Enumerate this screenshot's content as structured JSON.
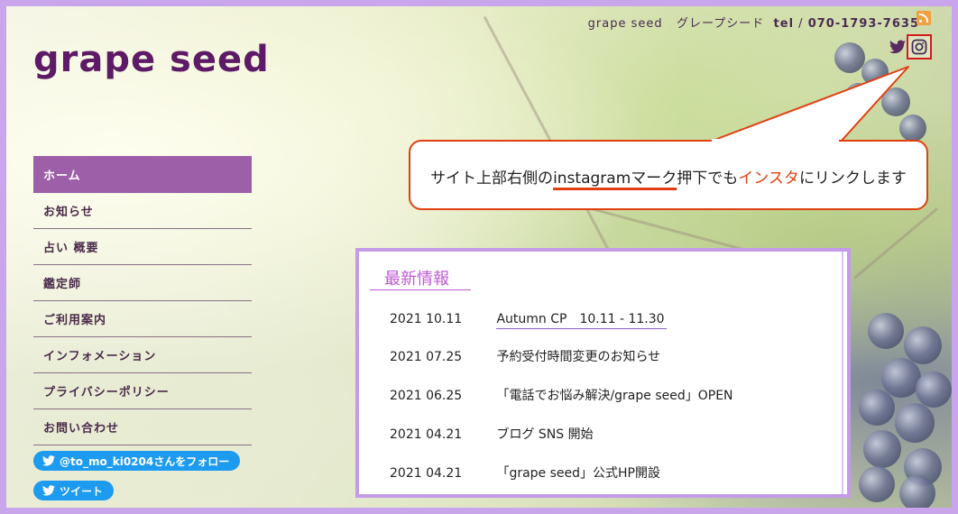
{
  "header": {
    "site_name_small": "grape seed",
    "site_name_kana": "グレープシード",
    "tel_label": "tel",
    "tel_number": "070-1793-7635",
    "rss_icon": "rss-icon",
    "twitter_icon": "twitter-icon",
    "instagram_icon": "instagram-icon",
    "highlight_color": "#d21b1b"
  },
  "site_title": "grape seed",
  "nav": {
    "items": [
      {
        "label": "ホーム",
        "active": true
      },
      {
        "label": "お知らせ"
      },
      {
        "label": "占い 概要"
      },
      {
        "label": "鑑定師"
      },
      {
        "label": "ご利用案内"
      },
      {
        "label": "インフォメーション"
      },
      {
        "label": "プライバシーポリシー"
      },
      {
        "label": "お問い合わせ"
      }
    ],
    "active_color": "#9d5fa8"
  },
  "twitter_widgets": {
    "follow_label": "@to_mo_ki0204さんをフォロー",
    "tweet_label": "ツイート",
    "color": "#1d9bf0"
  },
  "callout": {
    "part1": "サイト上部右側の",
    "part2": "instagramマーク",
    "part3": "押下でも",
    "part4": "インスタ",
    "part5": "にリンクします",
    "border_color": "#e04010"
  },
  "news": {
    "title": "最新情報",
    "items": [
      {
        "date": "2021 10.11",
        "text": "Autumn CP　10.11 - 11.30",
        "link": true
      },
      {
        "date": "2021 07.25",
        "text": "予約受付時間変更のお知らせ"
      },
      {
        "date": "2021 06.25",
        "text": "「電話でお悩み解決/grape seed」OPEN"
      },
      {
        "date": "2021 04.21",
        "text": "ブログ SNS 開始"
      },
      {
        "date": "2021 04.21",
        "text": "「grape seed」公式HP開設"
      }
    ]
  }
}
